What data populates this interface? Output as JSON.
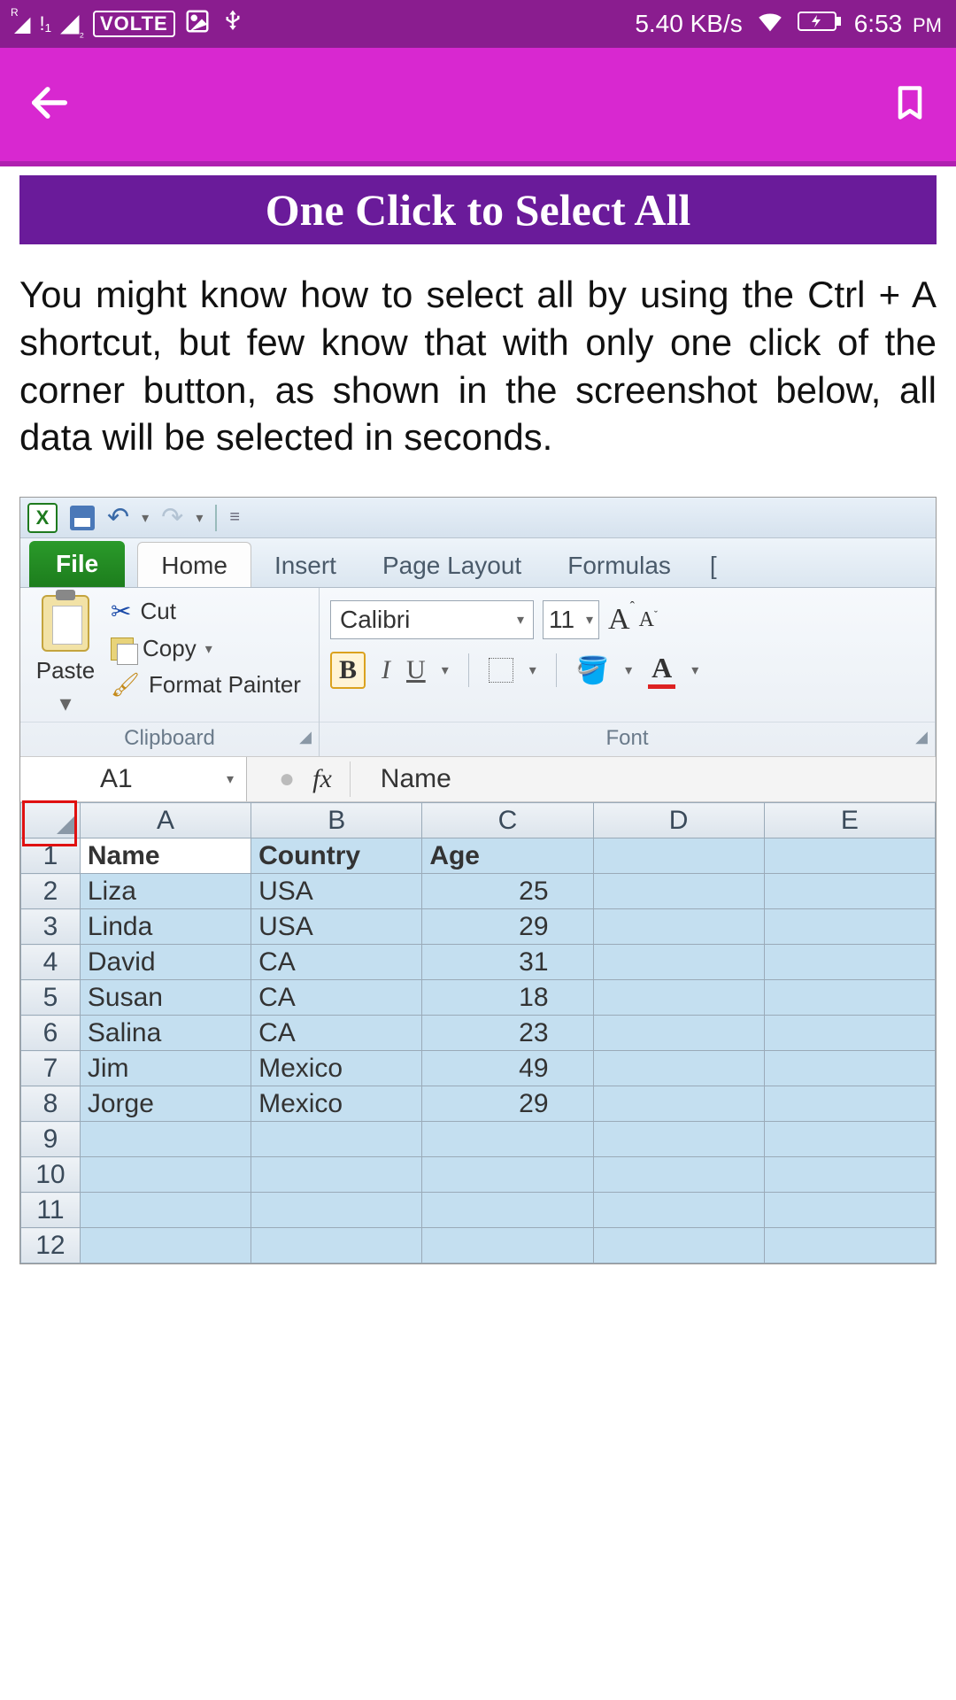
{
  "status_bar": {
    "signal_r": "R",
    "volte": "VOLTE",
    "speed": "5.40 KB/s",
    "time": "6:53",
    "ampm": "PM"
  },
  "article": {
    "title": "One Click to Select All",
    "body": "You might know how to select all by using the Ctrl + A shortcut, but few know that with only one click of the corner button, as shown in the screenshot below, all data will be selected in seconds."
  },
  "excel": {
    "qat": {
      "x_badge": "X",
      "undo_glyph": "↶",
      "redo_glyph": "↷"
    },
    "tabs": {
      "file": "File",
      "home": "Home",
      "insert": "Insert",
      "page_layout": "Page Layout",
      "formulas": "Formulas"
    },
    "ribbon": {
      "clipboard": {
        "paste": "Paste",
        "cut": "Cut",
        "copy": "Copy",
        "format_painter": "Format Painter",
        "group": "Clipboard"
      },
      "font": {
        "name": "Calibri",
        "size": "11",
        "bold": "B",
        "italic": "I",
        "underline": "U",
        "group": "Font",
        "font_color_letter": "A",
        "grow_a": "A",
        "shrink_a": "A"
      }
    },
    "namebox": {
      "ref": "A1",
      "fx": "fx",
      "value": "Name"
    },
    "columns": [
      "A",
      "B",
      "C",
      "D",
      "E"
    ],
    "headers": {
      "a": "Name",
      "b": "Country",
      "c": "Age"
    },
    "rows": [
      {
        "n": "2",
        "a": "Liza",
        "b": "USA",
        "c": "25"
      },
      {
        "n": "3",
        "a": "Linda",
        "b": "USA",
        "c": "29"
      },
      {
        "n": "4",
        "a": "David",
        "b": "CA",
        "c": "31"
      },
      {
        "n": "5",
        "a": "Susan",
        "b": "CA",
        "c": "18"
      },
      {
        "n": "6",
        "a": "Salina",
        "b": "CA",
        "c": "23"
      },
      {
        "n": "7",
        "a": "Jim",
        "b": "Mexico",
        "c": "49"
      },
      {
        "n": "8",
        "a": "Jorge",
        "b": "Mexico",
        "c": "29"
      }
    ],
    "empty_rows": [
      "9",
      "10",
      "11",
      "12"
    ]
  }
}
